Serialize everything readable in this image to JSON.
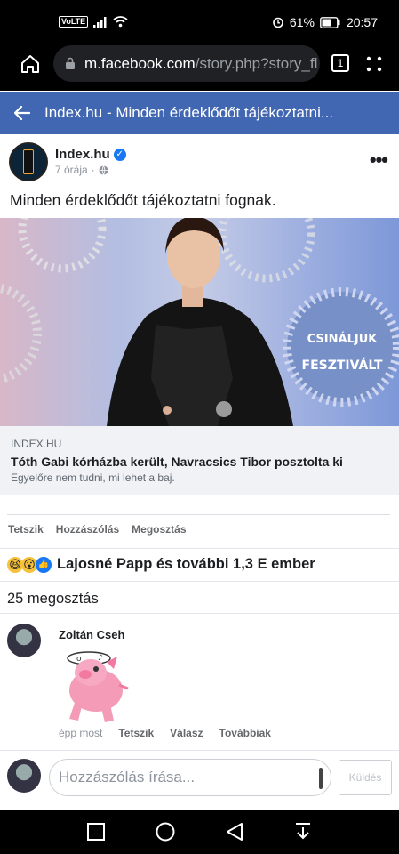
{
  "status_bar": {
    "network_badge": "VoLTE",
    "battery": "61%",
    "time": "20:57"
  },
  "browser": {
    "url_domain": "m.facebook.com",
    "url_path": "/story.php?story_fl",
    "tab_count": "1"
  },
  "fb_header": {
    "title": "Index.hu - Minden érdeklődőt tájékoztatni..."
  },
  "post": {
    "page_name": "Index.hu",
    "time_ago": "7 órája",
    "text": "Minden érdeklődőt tájékoztatni fognak.",
    "link": {
      "source": "INDEX.HU",
      "title": "Tóth Gabi kórházba került, Navracsics Tibor posztolta ki",
      "description": "Egyelőre nem tudni, mi lehet a baj."
    },
    "actions": {
      "like": "Tetszik",
      "comment": "Hozzászólás",
      "share": "Megosztás"
    },
    "reactions_text": "Lajosné Papp és további 1,3 E ember",
    "shares_text": "25 megosztás"
  },
  "comment": {
    "author": "Zoltán Cseh",
    "time": "épp most",
    "like": "Tetszik",
    "reply": "Válasz",
    "more": "Továbbiak"
  },
  "composer": {
    "placeholder": "Hozzászólás írása...",
    "send_label": "Küldés"
  },
  "colors": {
    "fb_blue": "#4267b2",
    "link_bg": "#f0f2f5"
  }
}
